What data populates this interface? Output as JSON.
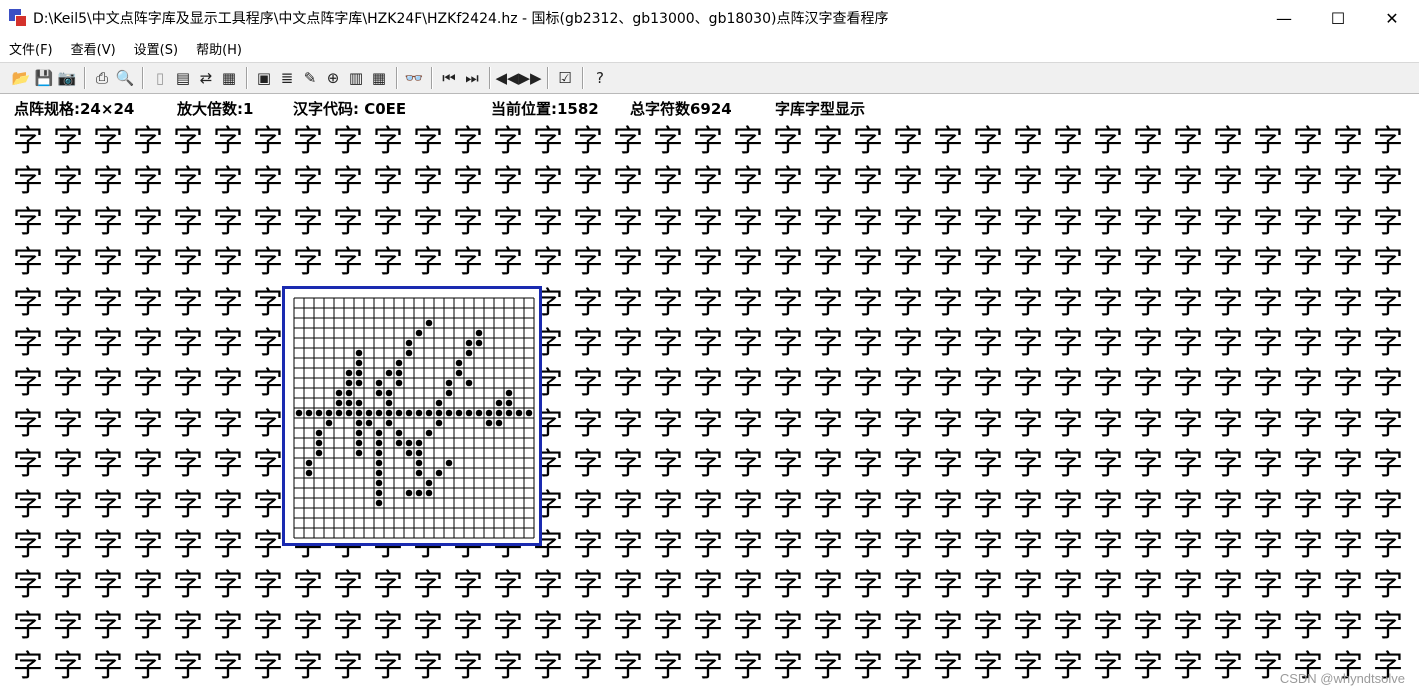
{
  "window": {
    "title": "D:\\Keil5\\中文点阵字库及显示工具程序\\中文点阵字库\\HZK24F\\HZKf2424.hz - 国标(gb2312、gb13000、gb18030)点阵汉字查看程序",
    "minimize_glyph": "—",
    "maximize_glyph": "☐",
    "close_glyph": "✕"
  },
  "menu": [
    {
      "label": "文件(F)"
    },
    {
      "label": "查看(V)"
    },
    {
      "label": "设置(S)"
    },
    {
      "label": "帮助(H)"
    }
  ],
  "toolbar": {
    "groups": [
      [
        {
          "icon": "open-folder-icon",
          "glyph": "📂",
          "enabled": true
        },
        {
          "icon": "save-icon",
          "glyph": "💾",
          "enabled": true
        },
        {
          "icon": "camera-icon",
          "glyph": "📷",
          "enabled": true
        }
      ],
      [
        {
          "icon": "print-icon",
          "glyph": "⎙",
          "enabled": true
        },
        {
          "icon": "print-preview-icon",
          "glyph": "🔍",
          "enabled": true
        }
      ],
      [
        {
          "icon": "new-page-icon",
          "glyph": "▯",
          "enabled": false
        },
        {
          "icon": "book-icon",
          "glyph": "▤",
          "enabled": true
        },
        {
          "icon": "font-convert-icon",
          "glyph": "⇄",
          "enabled": true
        },
        {
          "icon": "chart-icon",
          "glyph": "▦",
          "enabled": true
        }
      ],
      [
        {
          "icon": "font-view-icon",
          "glyph": "▣",
          "enabled": true
        },
        {
          "icon": "list-icon",
          "glyph": "≣",
          "enabled": true
        },
        {
          "icon": "edit-icon",
          "glyph": "✎",
          "enabled": true
        },
        {
          "icon": "zoom-icon",
          "glyph": "⊕",
          "enabled": true
        },
        {
          "icon": "grid-icon",
          "glyph": "▥",
          "enabled": true
        },
        {
          "icon": "calendar-icon",
          "glyph": "▦",
          "enabled": true
        }
      ],
      [
        {
          "icon": "binoculars-icon",
          "glyph": "👓",
          "enabled": true
        }
      ],
      [
        {
          "icon": "first-icon",
          "glyph": "⏮",
          "enabled": true
        },
        {
          "icon": "last-icon",
          "glyph": "⏭",
          "enabled": true
        }
      ],
      [
        {
          "icon": "prev-icon",
          "glyph": "◀◀",
          "enabled": true
        },
        {
          "icon": "next-icon",
          "glyph": "▶▶",
          "enabled": true
        }
      ],
      [
        {
          "icon": "properties-icon",
          "glyph": "☑",
          "enabled": true
        }
      ],
      [
        {
          "icon": "help-icon",
          "glyph": "?",
          "enabled": true
        }
      ]
    ]
  },
  "info": {
    "dot_matrix": "点阵规格:24×24",
    "zoom": "放大倍数:1",
    "code": "汉字代码: C0EE",
    "position": "当前位置:1582",
    "total": "总字符数6924",
    "font_display": "字库字型显示"
  },
  "glyphs": {
    "placeholder_char": "字",
    "rows": 14,
    "cols": 35
  },
  "zoom_panel": {
    "grid_size": 24,
    "pixels": [
      "000000000000000000000000",
      "000000000000000000000000",
      "000000000000010000000000",
      "000000000000100000100000",
      "000000000001000001100000",
      "000000100001000001000000",
      "000000100010000010000000",
      "000001100110000010000000",
      "000001101010000101000000",
      "000011001100000100000100",
      "000011100100001000001100",
      "111111111111111111111111",
      "000100110100001000011000",
      "001000101010010000000000",
      "001000101011100000000000",
      "001000101001100000000000",
      "010000001000100100000000",
      "010000001000101000000000",
      "000000001000010000000000",
      "000000001001110000000000",
      "000000001000000000000000",
      "000000000000000000000000",
      "000000000000000000000000",
      "000000000000000000000000"
    ]
  },
  "watermark": "CSDN @whyndtsolve"
}
